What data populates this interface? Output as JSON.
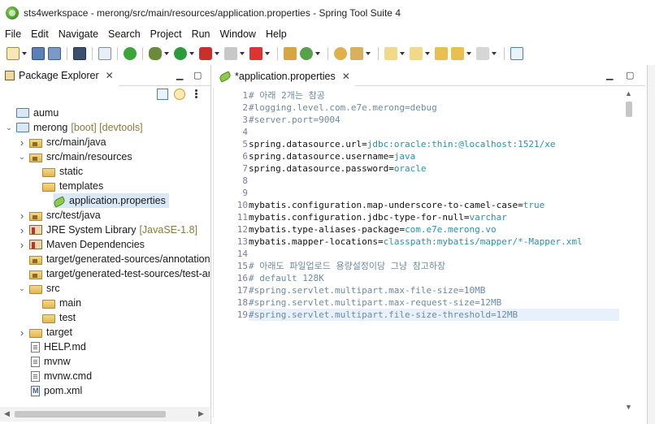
{
  "window": {
    "title": "sts4werkspace - merong/src/main/resources/application.properties - Spring Tool Suite 4"
  },
  "menu": [
    "File",
    "Edit",
    "Navigate",
    "Search",
    "Project",
    "Run",
    "Window",
    "Help"
  ],
  "package_explorer": {
    "tab_label": "Package Explorer",
    "tree": [
      {
        "label": "aumu",
        "deco": "",
        "icon": "project-icon",
        "indent": 0,
        "twisty": ""
      },
      {
        "label": "merong",
        "deco": "[boot] [devtools]",
        "icon": "project-icon",
        "indent": 0,
        "twisty": "v"
      },
      {
        "label": "src/main/java",
        "deco": "",
        "icon": "source-folder-icon",
        "indent": 1,
        "twisty": ">"
      },
      {
        "label": "src/main/resources",
        "deco": "",
        "icon": "source-folder-icon",
        "indent": 1,
        "twisty": "v"
      },
      {
        "label": "static",
        "deco": "",
        "icon": "folder-icon",
        "indent": 2,
        "twisty": ""
      },
      {
        "label": "templates",
        "deco": "",
        "icon": "folder-icon",
        "indent": 2,
        "twisty": ""
      },
      {
        "label": "application.properties",
        "deco": "",
        "icon": "properties-file-icon",
        "indent": 2,
        "twisty": "",
        "selected": true
      },
      {
        "label": "src/test/java",
        "deco": "",
        "icon": "source-folder-icon",
        "indent": 1,
        "twisty": ">"
      },
      {
        "label": "JRE System Library",
        "deco": "[JavaSE-1.8]",
        "icon": "library-icon",
        "indent": 1,
        "twisty": ">"
      },
      {
        "label": "Maven Dependencies",
        "deco": "",
        "icon": "library-icon",
        "indent": 1,
        "twisty": ">"
      },
      {
        "label": "target/generated-sources/annotations",
        "deco": "",
        "icon": "source-folder-icon",
        "indent": 1,
        "twisty": ""
      },
      {
        "label": "target/generated-test-sources/test-an",
        "deco": "",
        "icon": "source-folder-icon",
        "indent": 1,
        "twisty": ""
      },
      {
        "label": "src",
        "deco": "",
        "icon": "folder-icon",
        "indent": 1,
        "twisty": "v"
      },
      {
        "label": "main",
        "deco": "",
        "icon": "folder-icon",
        "indent": 2,
        "twisty": ""
      },
      {
        "label": "test",
        "deco": "",
        "icon": "folder-icon",
        "indent": 2,
        "twisty": ""
      },
      {
        "label": "target",
        "deco": "",
        "icon": "folder-icon",
        "indent": 1,
        "twisty": ">"
      },
      {
        "label": "HELP.md",
        "deco": "",
        "icon": "file-icon",
        "indent": 1,
        "twisty": ""
      },
      {
        "label": "mvnw",
        "deco": "",
        "icon": "file-icon",
        "indent": 1,
        "twisty": ""
      },
      {
        "label": "mvnw.cmd",
        "deco": "",
        "icon": "file-icon",
        "indent": 1,
        "twisty": ""
      },
      {
        "label": "pom.xml",
        "deco": "",
        "icon": "xml-file-icon",
        "indent": 1,
        "twisty": ""
      }
    ]
  },
  "editor": {
    "tab_label": "*application.properties",
    "lines": [
      [
        {
          "t": "# 아래 2개는 참공",
          "c": "cmt"
        }
      ],
      [
        {
          "t": "#logging.level.com.e7e.merong=debug",
          "c": "cmt"
        }
      ],
      [
        {
          "t": "#server.port=9004",
          "c": "cmt"
        }
      ],
      [],
      [
        {
          "t": "spring.datasource.url",
          "c": "key"
        },
        {
          "t": "=",
          "c": "eq"
        },
        {
          "t": "jdbc:oracle:thin:@localhost:1521/xe",
          "c": "val"
        }
      ],
      [
        {
          "t": "spring.datasource.username",
          "c": "key"
        },
        {
          "t": "=",
          "c": "eq"
        },
        {
          "t": "java",
          "c": "val"
        }
      ],
      [
        {
          "t": "spring.datasource.password",
          "c": "key"
        },
        {
          "t": "=",
          "c": "eq"
        },
        {
          "t": "oracle",
          "c": "val"
        }
      ],
      [],
      [],
      [
        {
          "t": "mybatis.configuration.map-underscore-to-camel-case",
          "c": "key"
        },
        {
          "t": "=",
          "c": "eq"
        },
        {
          "t": "true",
          "c": "val"
        }
      ],
      [
        {
          "t": "mybatis.configuration.jdbc-type-for-null",
          "c": "key"
        },
        {
          "t": "=",
          "c": "eq"
        },
        {
          "t": "varchar",
          "c": "val"
        }
      ],
      [
        {
          "t": "mybatis.type-aliases-package",
          "c": "key"
        },
        {
          "t": "=",
          "c": "eq"
        },
        {
          "t": "com.e7e.merong.vo",
          "c": "val"
        }
      ],
      [
        {
          "t": "mybatis.mapper-locations",
          "c": "key"
        },
        {
          "t": "=",
          "c": "eq"
        },
        {
          "t": "classpath:mybatis/mapper/*-Mapper.xml",
          "c": "val"
        }
      ],
      [],
      [
        {
          "t": "# 아래도 파일업로드 용량설정이당 그냥 참고하장",
          "c": "cmt"
        }
      ],
      [
        {
          "t": "# default 128K",
          "c": "cmt"
        }
      ],
      [
        {
          "t": "#spring.servlet.multipart.max-file-size=10MB",
          "c": "cmt"
        }
      ],
      [
        {
          "t": "#spring.servlet.multipart.max-request-size=12MB",
          "c": "cmt"
        }
      ],
      [
        {
          "t": "#spring.servlet.multipart.file-size-threshold=12MB",
          "c": "cmt"
        }
      ]
    ],
    "line_numbers": [
      "1",
      "2",
      "3",
      "4",
      "5",
      "6",
      "7",
      "8",
      "9",
      "10",
      "11",
      "12",
      "13",
      "14",
      "15",
      "16",
      "17",
      "18",
      "19"
    ],
    "current_line": 19
  },
  "colors": {
    "comment": "#6d8aa3",
    "value": "#2a8fb0",
    "selection": "#d9e8f6",
    "current_line": "#e8f0fb"
  }
}
